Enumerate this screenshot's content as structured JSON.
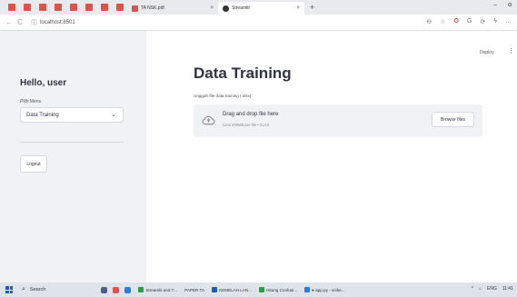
{
  "browser": {
    "pdf_tab": "TA NSK.pdf",
    "active_tab": "Streamlit",
    "close_glyph": "×",
    "new_tab_glyph": "+",
    "minimize_glyph": "–",
    "maximize_glyph": "ɑ",
    "url": "localhost:8501",
    "back_glyph": "←",
    "reload_glyph": "C",
    "info_glyph": "ⓘ",
    "icons": [
      "⊖",
      "☆",
      "O",
      "G",
      "⟳",
      "ϟ",
      "…"
    ]
  },
  "sidebar": {
    "greeting": "Hello, user",
    "menu_label": "Pilih Menu",
    "menu_selected": "Data Training",
    "chevron": "⌄",
    "logout_label": "Logout"
  },
  "main": {
    "deploy_label": "Deploy",
    "kebab": "⋮",
    "title": "Data Training",
    "uploader_label": "Unggah file data training (.xlsx):",
    "drop_text": "Drag and drop file here",
    "limit_text": "Limit 200MB per file • XLSX",
    "browse_label": "Browse files"
  },
  "taskbar": {
    "search_glyph": "⌕",
    "search_label": "Search",
    "items": [
      "Streamlit and 7...",
      "PAPER TA",
      "KEMELAH LAN...",
      "Hitung Confusi...",
      "● app.py - scibe..."
    ],
    "tray": [
      "^",
      "⌂",
      "ENG",
      "11:41"
    ]
  },
  "colors": {
    "sidebar_bg": "#f0f2f6",
    "dropzone_bg": "#f0f2f6",
    "text_primary": "#31333f",
    "pdf_red": "#d9534f",
    "taskbar_bg": "#dfe3ea"
  }
}
